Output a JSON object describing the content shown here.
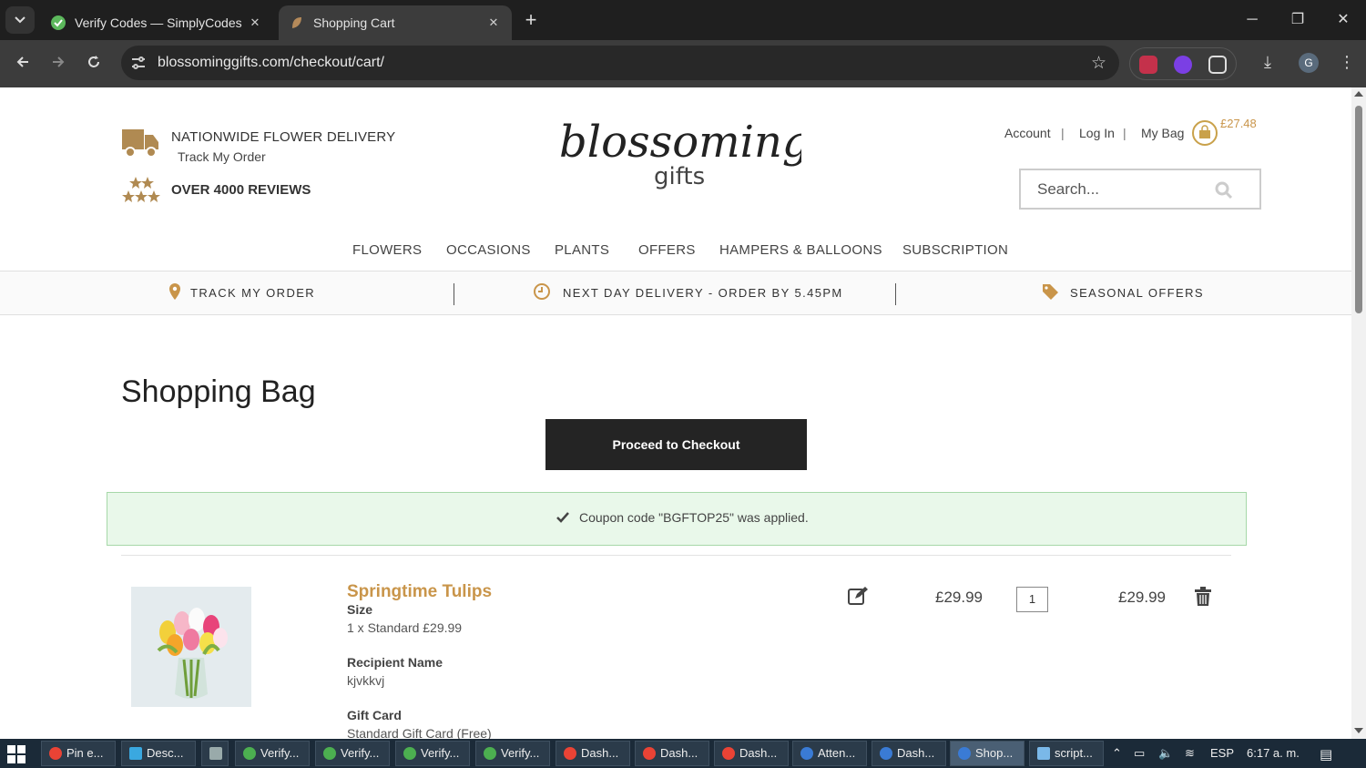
{
  "browser": {
    "tabs": [
      {
        "title": "Verify Codes — SimplyCodes",
        "active": false
      },
      {
        "title": "Shopping Cart",
        "active": true
      }
    ],
    "url": "blossominggifts.com/checkout/cart/",
    "profile_initial": "G"
  },
  "header": {
    "delivery_text": "NATIONWIDE FLOWER DELIVERY",
    "track_link": "Track My Order",
    "reviews_text": "OVER 4000 REVIEWS",
    "logo_main": "blossoming",
    "logo_sub": "gifts",
    "account_links": [
      "Account",
      "Log In",
      "My Bag"
    ],
    "bag_amount": "£27.48",
    "search_placeholder": "Search..."
  },
  "nav": [
    "FLOWERS",
    "OCCASIONS",
    "PLANTS",
    "OFFERS",
    "HAMPERS & BALLOONS",
    "SUBSCRIPTION"
  ],
  "infobar": {
    "track": "TRACK MY ORDER",
    "delivery": "NEXT DAY DELIVERY - ORDER BY 5.45PM",
    "offers": "SEASONAL OFFERS"
  },
  "cart": {
    "title": "Shopping Bag",
    "checkout_label": "Proceed to Checkout",
    "coupon_message": "Coupon code \"BGFTOP25\" was applied.",
    "item": {
      "name": "Springtime Tulips",
      "size_label": "Size",
      "size_value": "1 x Standard £29.99",
      "recipient_label": "Recipient Name",
      "recipient_value": "kjvkkvj",
      "giftcard_label": "Gift Card",
      "giftcard_value": "Standard Gift Card (Free)",
      "price": "£29.99",
      "quantity": "1",
      "subtotal": "£29.99"
    }
  },
  "taskbar": {
    "items": [
      "Pin e...",
      "Desc...",
      "",
      "Verify...",
      "Verify...",
      "Verify...",
      "Verify...",
      "Dash...",
      "Dash...",
      "Dash...",
      "Atten...",
      "Dash...",
      "Shop...",
      "script..."
    ],
    "language": "ESP",
    "time": "6:17 a. m."
  },
  "colors": {
    "accent_gold": "#c9954a",
    "button_dark": "#242424",
    "notice_bg": "#e9f8ea"
  }
}
